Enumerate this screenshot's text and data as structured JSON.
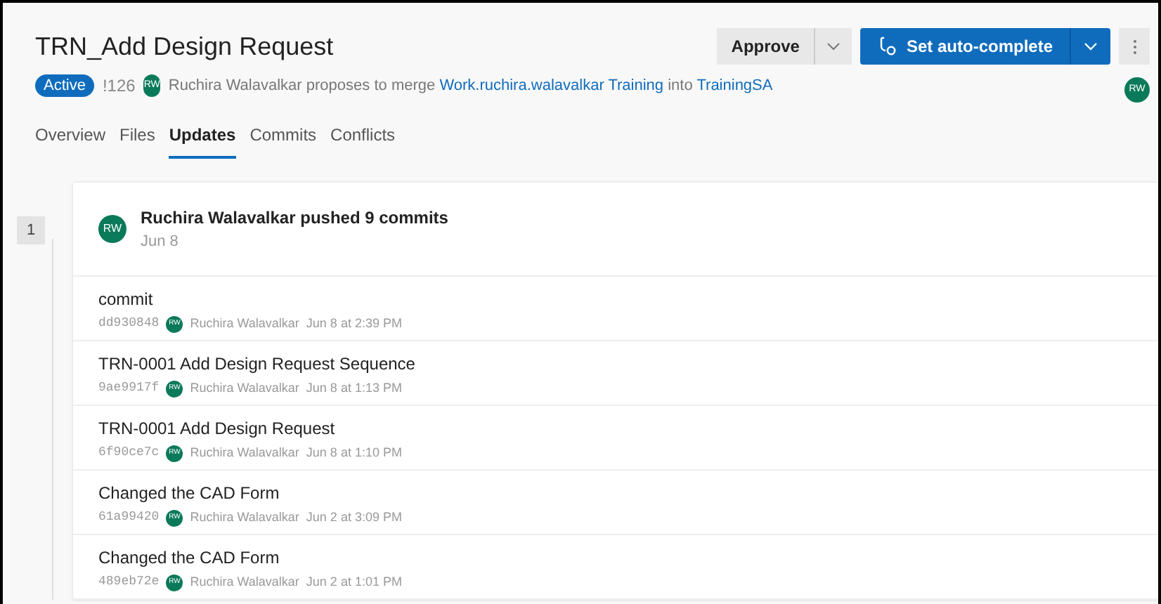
{
  "title": "TRN_Add Design Request",
  "status": "Active",
  "pr_id": "!126",
  "author_initials": "RW",
  "merge_text": {
    "author": "Ruchira Walavalkar",
    "proposes": "proposes to merge",
    "source": "Work.ruchira.walavalkar Training",
    "into": "into",
    "target": "TrainingSA"
  },
  "actions": {
    "approve": "Approve",
    "auto_complete": "Set auto-complete",
    "reviewer_initials": "RW"
  },
  "tabs": [
    {
      "label": "Overview",
      "selected": false
    },
    {
      "label": "Files",
      "selected": false
    },
    {
      "label": "Updates",
      "selected": true
    },
    {
      "label": "Commits",
      "selected": false
    },
    {
      "label": "Conflicts",
      "selected": false
    }
  ],
  "update": {
    "number": "1",
    "initials": "RW",
    "title": "Ruchira Walavalkar pushed 9 commits",
    "date": "Jun 8",
    "commits": [
      {
        "message": "commit",
        "hash": "dd930848",
        "initials": "RW",
        "author": "Ruchira Walavalkar",
        "time": "Jun 8 at 2:39 PM"
      },
      {
        "message": "TRN-0001 Add Design Request Sequence",
        "hash": "9ae9917f",
        "initials": "RW",
        "author": "Ruchira Walavalkar",
        "time": "Jun 8 at 1:13 PM"
      },
      {
        "message": "TRN-0001 Add Design Request",
        "hash": "6f90ce7c",
        "initials": "RW",
        "author": "Ruchira Walavalkar",
        "time": "Jun 8 at 1:10 PM"
      },
      {
        "message": "Changed the CAD Form",
        "hash": "61a99420",
        "initials": "RW",
        "author": "Ruchira Walavalkar",
        "time": "Jun 2 at 3:09 PM"
      },
      {
        "message": "Changed the CAD Form",
        "hash": "489eb72e",
        "initials": "RW",
        "author": "Ruchira Walavalkar",
        "time": "Jun 2 at 1:01 PM"
      }
    ]
  }
}
